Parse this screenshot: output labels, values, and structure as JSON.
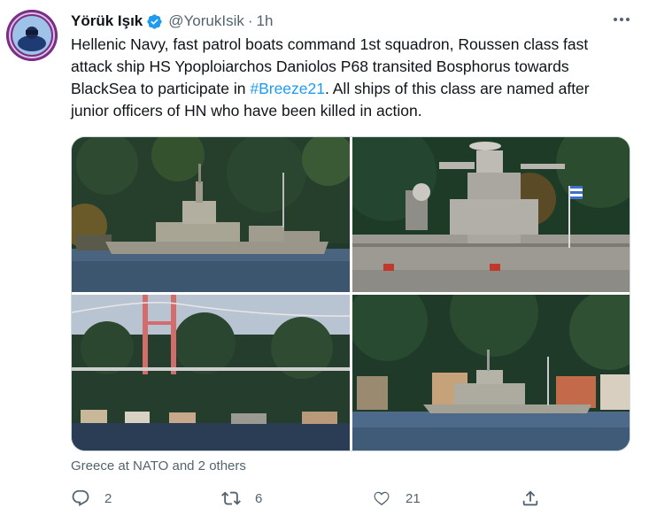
{
  "tweet": {
    "author_name": "Yörük Işık",
    "handle": "@YorukIsik",
    "separator": "·",
    "time": "1h",
    "lines": [
      "Hellenic Navy, fast patrol boats command 1st squadron, Roussen class fast",
      "attack ship HS Ypoploiarchos Daniolos P68 transited Bosphorus towards",
      "BlackSea to participate in ",
      "junior officers of HN who have been killed in action."
    ],
    "hashtag": "#Breeze21",
    "line3_tail": ". All ships of this class are named after",
    "tagged": "Greece at NATO and 2 others"
  },
  "actions": {
    "reply_count": "2",
    "retweet_count": "6",
    "like_count": "21"
  },
  "icons": {
    "verified": "verified-badge-icon",
    "more": "more-horizontal-icon",
    "reply": "reply-icon",
    "retweet": "retweet-icon",
    "like": "heart-icon",
    "share": "share-icon"
  },
  "colors": {
    "link": "#1d9bf0",
    "muted": "#536471",
    "text": "#0f1419"
  }
}
